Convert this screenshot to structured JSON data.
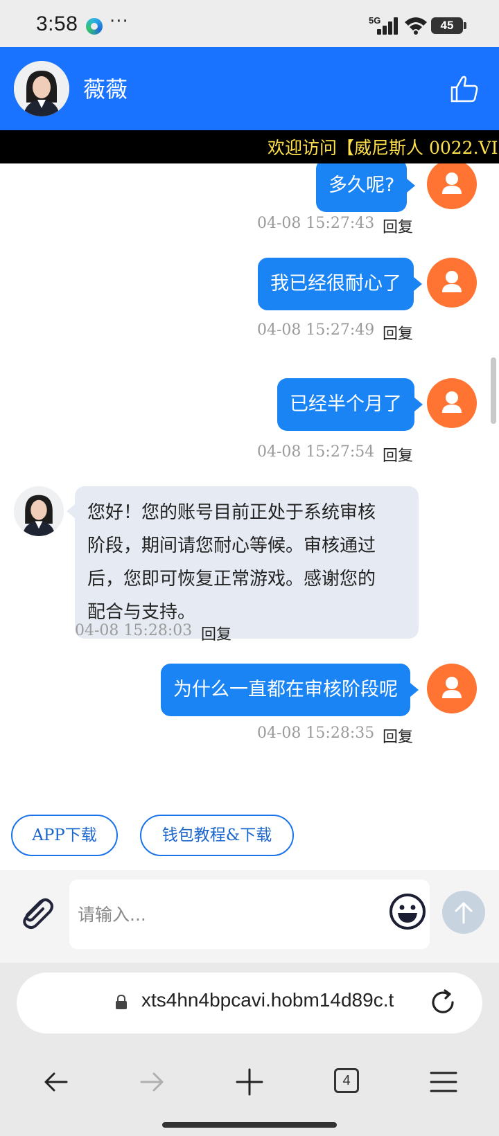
{
  "status_bar": {
    "time": "3:58",
    "more": "···",
    "network": "5G",
    "battery": "45"
  },
  "header": {
    "contact_name": "薇薇"
  },
  "marquee": {
    "text": "欢迎访问【威尼斯人 0022.VI"
  },
  "messages": [
    {
      "direction": "out",
      "text": "多久呢?",
      "time": "04-08 15:27:43",
      "reply": "回复"
    },
    {
      "direction": "out",
      "text": "我已经很耐心了",
      "time": "04-08 15:27:49",
      "reply": "回复"
    },
    {
      "direction": "out",
      "text": "已经半个月了",
      "time": "04-08 15:27:54",
      "reply": "回复"
    },
    {
      "direction": "in",
      "lines": [
        "您好！您的账号目前正处于系统审核",
        "阶段，期间请您耐心等候。审核通过",
        "后，您即可恢复正常游戏。感谢您的",
        "配合与支持。"
      ],
      "time": "04-08 15:28:03",
      "reply": "回复"
    },
    {
      "direction": "out",
      "text": "为什么一直都在审核阶段呢",
      "time": "04-08 15:28:35",
      "reply": "回复"
    }
  ],
  "quick_buttons": {
    "app_download": "APP下载",
    "wallet_tutorial": "钱包教程&下载"
  },
  "input": {
    "placeholder": "请输入..."
  },
  "browser": {
    "url": "xts4hn4bpcavi.hobm14d89c.t",
    "tab_count": "4"
  },
  "colors": {
    "header_blue": "#1a73ff",
    "bubble_blue": "#1a84f5",
    "user_avatar_orange": "#ff7433",
    "marquee_yellow": "#ffe14a"
  }
}
